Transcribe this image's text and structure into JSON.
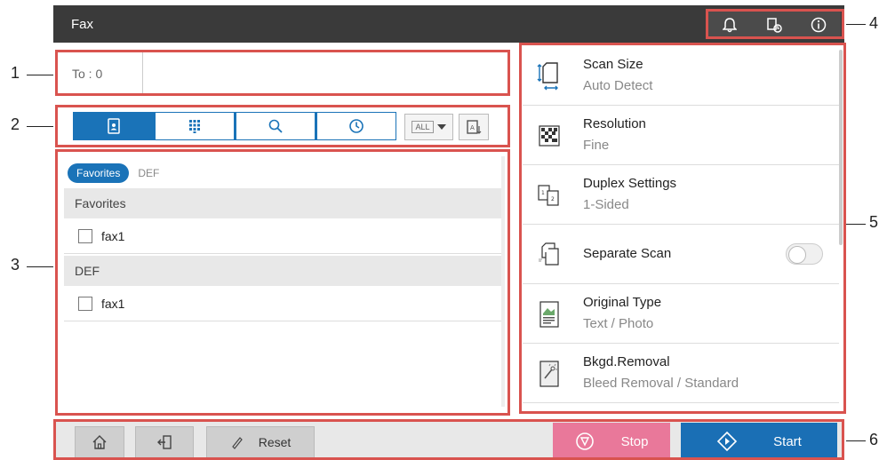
{
  "titlebar": {
    "title": "Fax",
    "icons": [
      "bell-icon",
      "toner-icon",
      "info-icon"
    ]
  },
  "to_field": {
    "label": "To : 0"
  },
  "tabs": [
    {
      "icon": "address-book-icon",
      "active": true
    },
    {
      "icon": "keypad-icon",
      "active": false
    },
    {
      "icon": "search-icon",
      "active": false
    },
    {
      "icon": "history-icon",
      "active": false
    }
  ],
  "filter": {
    "all_label": "ALL"
  },
  "list": {
    "chips": [
      "Favorites",
      "DEF"
    ],
    "groups": [
      {
        "header": "Favorites",
        "items": [
          "fax1"
        ]
      },
      {
        "header": "DEF",
        "items": [
          "fax1"
        ]
      }
    ]
  },
  "settings": [
    {
      "title": "Scan Size",
      "value": "Auto Detect",
      "icon": "scan-size-icon"
    },
    {
      "title": "Resolution",
      "value": "Fine",
      "icon": "resolution-icon"
    },
    {
      "title": "Duplex Settings",
      "value": "1-Sided",
      "icon": "duplex-icon"
    },
    {
      "title": "Separate Scan",
      "value": "",
      "icon": "separate-scan-icon",
      "toggle": false
    },
    {
      "title": "Original Type",
      "value": "Text / Photo",
      "icon": "original-type-icon"
    },
    {
      "title": "Bkgd.Removal",
      "value": "Bleed Removal / Standard",
      "icon": "background-removal-icon"
    }
  ],
  "bottom": {
    "reset_label": "Reset",
    "stop_label": "Stop",
    "start_label": "Start"
  },
  "callouts": [
    "1",
    "2",
    "3",
    "4",
    "5",
    "6"
  ],
  "colors": {
    "accent": "#1a73b8",
    "frame": "#d9534f",
    "stop": "#e9789a",
    "start": "#1a6fb5",
    "titlebar": "#3a3a3a"
  }
}
